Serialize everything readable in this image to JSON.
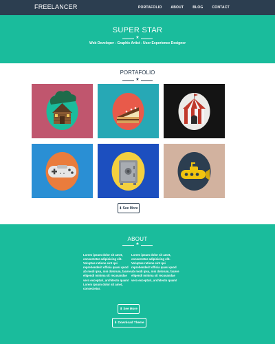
{
  "navbar": {
    "brand": "FREELANCER",
    "links": [
      "PORTAFOLIO",
      "ABOUT",
      "BLOG",
      "CONTACT"
    ]
  },
  "hero": {
    "title": "SUPER STAR",
    "subtitle": "Web Developer - Graphic Artist - User Experience Designer"
  },
  "portfolio": {
    "title": "PORTAFOLIO",
    "items": [
      {
        "icon": "cabin-icon",
        "bg": "#c0566e"
      },
      {
        "icon": "cake-icon",
        "bg": "#27a8b5"
      },
      {
        "icon": "circus-tent-icon",
        "bg": "#141414"
      },
      {
        "icon": "game-controller-icon",
        "bg": "#2a8fd4"
      },
      {
        "icon": "safe-icon",
        "bg": "#1c4fbf"
      },
      {
        "icon": "submarine-icon",
        "bg": "#d2b29f"
      }
    ],
    "button_label": "See More"
  },
  "about": {
    "title": "ABOUT",
    "col_left": "Lorem ipsum dolor sit amet, consectetur adipisicing elit. Voluptas ratione sint qui reprehenderit officia quasi quod ab modi ipsa, nisi dolorum, facere eligendi minima sit recusandae vero excepturi, architecto quam! Lorem ipsum dolor sit amet, consectetur.",
    "col_right": "Lorem ipsum dolor sit amet, consectetur adipisicing elit. Voluptas ratione sint qui reprehenderit officia quasi quod ab modi ipsa, nisi dolorum, facere eligendi minima sit recusandae vero excepturi, architecto quam!",
    "see_more_label": "See More",
    "download_label": "Download Theme"
  },
  "colors": {
    "navbar": "#2c3e50",
    "accent": "#1abc9c",
    "text_light": "#ffffff"
  }
}
